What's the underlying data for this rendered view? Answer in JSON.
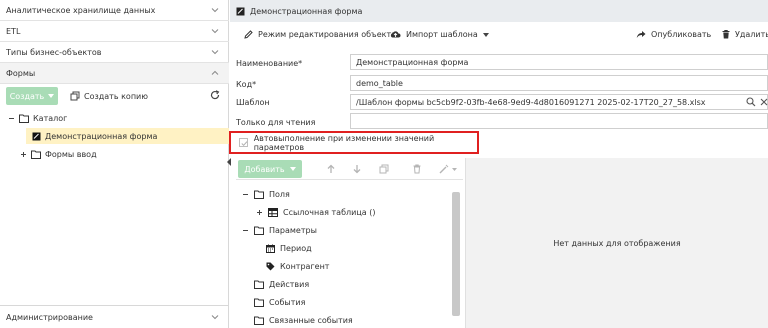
{
  "sidebar": {
    "sections": [
      {
        "label": "Аналитическое хранилище данных"
      },
      {
        "label": "ETL"
      },
      {
        "label": "Типы бизнес-объектов"
      },
      {
        "label": "Формы"
      }
    ],
    "create_label": "Создать",
    "copy_label": "Создать копию",
    "tree": {
      "catalog": "Каталог",
      "demo_form": "Демонстрационная форма",
      "input_forms": "Формы ввод"
    },
    "bottom_label": "Администрирование"
  },
  "header": {
    "title": "Демонстрационная форма"
  },
  "actions": {
    "edit_mode": "Режим редактирования объекта",
    "import_template": "Импорт шаблона",
    "publish": "Опубликовать",
    "delete": "Удалить"
  },
  "form": {
    "name_label": "Наименование*",
    "name_value": "Демонстрационная форма",
    "code_label": "Код*",
    "code_value": "demo_table",
    "template_label": "Шаблон",
    "template_value": "/Шаблон формы bc5cb9f2-03fb-4e68-9ed9-4d8016091271 2025-02-17T20_27_58.xlsx",
    "readonly_label": "Только для чтения",
    "readonly_value": "",
    "autorun_label": "Автовыполнение при изменении значений параметров"
  },
  "tree_panel": {
    "add_label": "Добавить",
    "items": [
      {
        "label": "Поля"
      },
      {
        "label": "Ссылочная таблица ()"
      },
      {
        "label": "Параметры"
      },
      {
        "label": "Период"
      },
      {
        "label": "Контрагент"
      },
      {
        "label": "Действия"
      },
      {
        "label": "События"
      },
      {
        "label": "Связанные события"
      }
    ]
  },
  "empty_text": "Нет данных для отображения",
  "colors": {
    "accent_green": "#a9dcb6",
    "highlight_red": "#e02020",
    "selection": "#fff2c4"
  }
}
